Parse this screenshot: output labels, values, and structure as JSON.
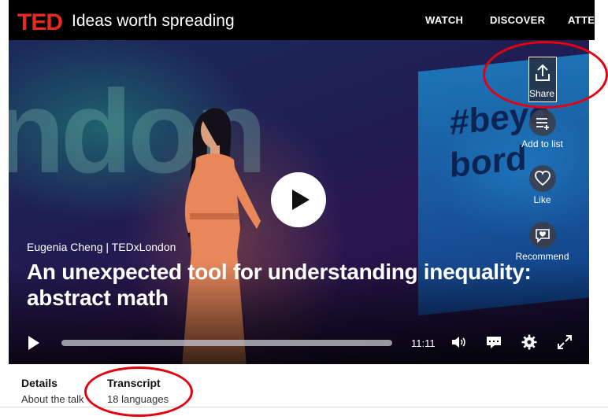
{
  "header": {
    "logo": "TED",
    "tagline": "Ideas worth spreading",
    "nav": [
      "WATCH",
      "DISCOVER",
      "ATTEN"
    ]
  },
  "video": {
    "speaker_line": "Eugenia Cheng | TEDxLondon",
    "title": "An unexpected tool for understanding inequality: abstract math",
    "backdrop_letters": "ndon",
    "screen_text": "#beyo bord",
    "duration": "11:11",
    "progress": 0
  },
  "actions": {
    "share": "Share",
    "add_to_list": "Add to list",
    "like": "Like",
    "recommend": "Recommend"
  },
  "tabs": [
    {
      "title": "Details",
      "subtitle": "About the talk"
    },
    {
      "title": "Transcript",
      "subtitle": "18 languages"
    }
  ],
  "colors": {
    "brand": "#e62b1e",
    "annotation": "#e4000f"
  }
}
